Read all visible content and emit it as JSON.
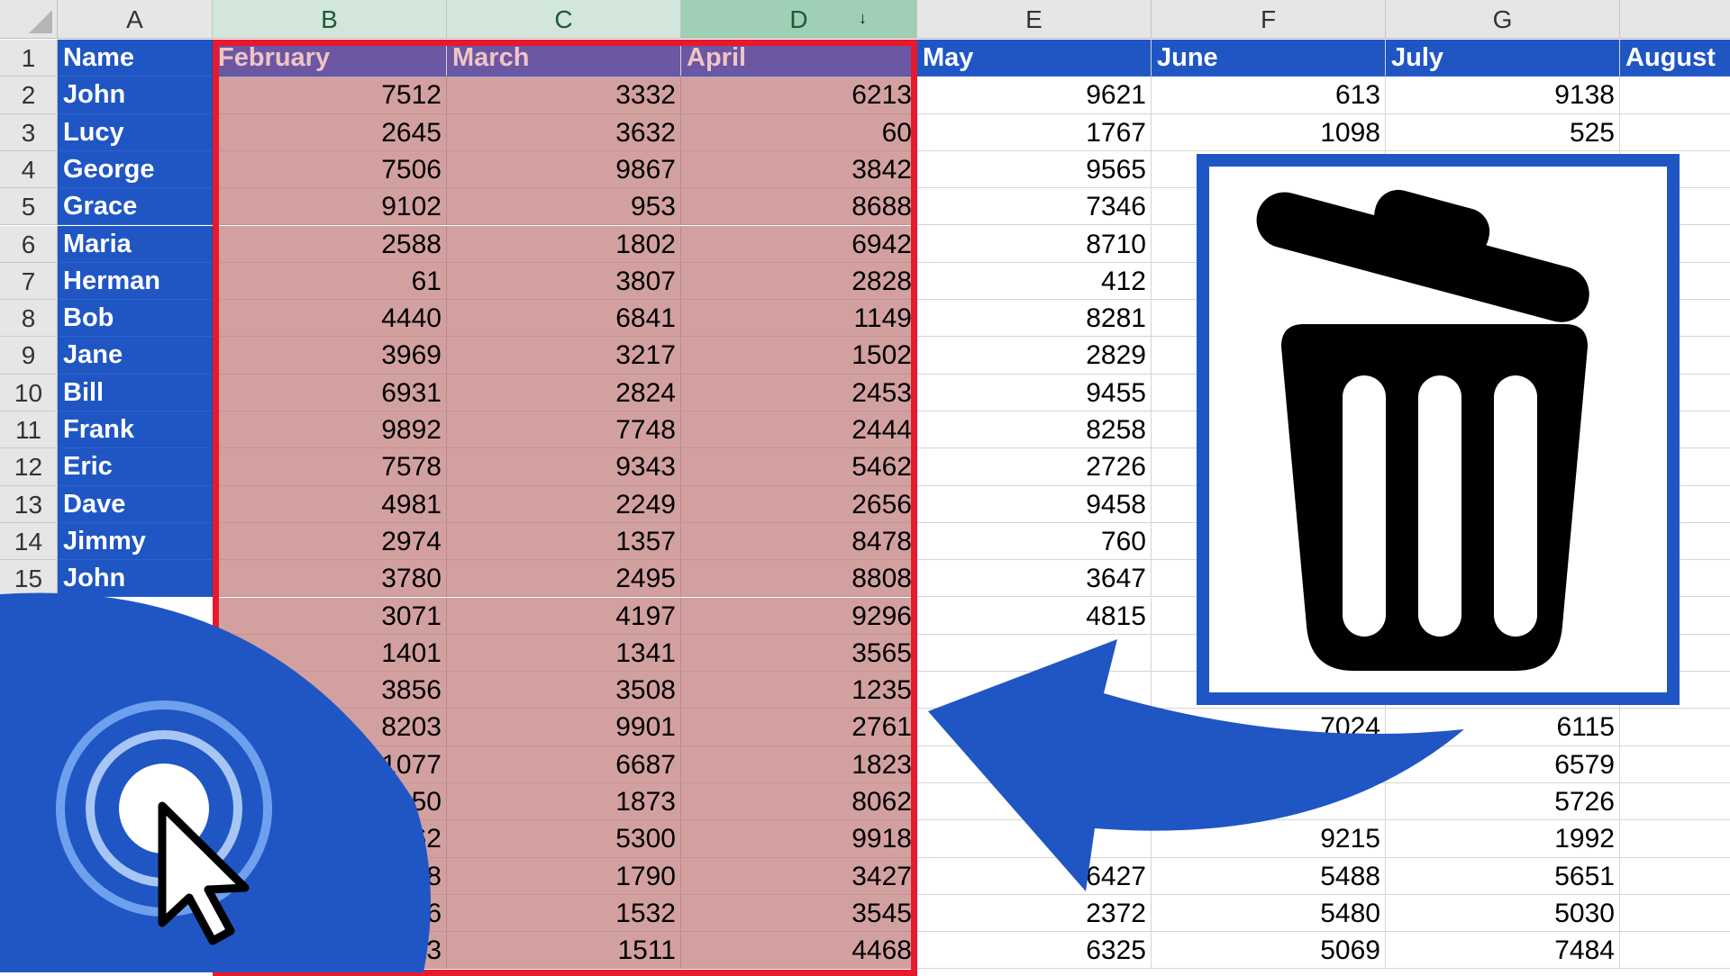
{
  "spreadsheet": {
    "column_letters": [
      "A",
      "B",
      "C",
      "D",
      "E",
      "F",
      "G",
      ""
    ],
    "row_numbers": [
      "1",
      "2",
      "3",
      "4",
      "5",
      "6",
      "7",
      "8",
      "9",
      "10",
      "11",
      "12",
      "13",
      "14",
      "15"
    ],
    "header_row": [
      "Name",
      "February",
      "March",
      "April",
      "May",
      "June",
      "July",
      "August"
    ],
    "names": [
      "John",
      "Lucy",
      "George",
      "Grace",
      "Maria",
      "Herman",
      "Bob",
      "Jane",
      "Bill",
      "Frank",
      "Eric",
      "Dave",
      "Jimmy",
      "John"
    ],
    "rows": [
      [
        "7512",
        "3332",
        "6213",
        "9621",
        "613",
        "9138"
      ],
      [
        "2645",
        "3632",
        "60",
        "1767",
        "1098",
        "525"
      ],
      [
        "7506",
        "9867",
        "3842",
        "9565",
        "",
        ""
      ],
      [
        "9102",
        "953",
        "8688",
        "7346",
        "",
        ""
      ],
      [
        "2588",
        "1802",
        "6942",
        "8710",
        "",
        ""
      ],
      [
        "61",
        "3807",
        "2828",
        "412",
        "",
        ""
      ],
      [
        "4440",
        "6841",
        "1149",
        "8281",
        "",
        ""
      ],
      [
        "3969",
        "3217",
        "1502",
        "2829",
        "",
        ""
      ],
      [
        "6931",
        "2824",
        "2453",
        "9455",
        "",
        ""
      ],
      [
        "9892",
        "7748",
        "2444",
        "8258",
        "",
        ""
      ],
      [
        "7578",
        "9343",
        "5462",
        "2726",
        "",
        ""
      ],
      [
        "4981",
        "2249",
        "2656",
        "9458",
        "",
        ""
      ],
      [
        "2974",
        "1357",
        "8478",
        "760",
        "",
        ""
      ],
      [
        "3780",
        "2495",
        "8808",
        "3647",
        "",
        ""
      ],
      [
        "3071",
        "4197",
        "9296",
        "4815",
        "",
        ""
      ],
      [
        "1401",
        "1341",
        "3565",
        "",
        "",
        ""
      ],
      [
        "3856",
        "3508",
        "1235",
        "",
        "",
        ""
      ],
      [
        "8203",
        "9901",
        "2761",
        "",
        "7024",
        "6115"
      ],
      [
        "1077",
        "6687",
        "1823",
        "",
        "",
        "6579"
      ],
      [
        "9150",
        "1873",
        "8062",
        "",
        "",
        "5726"
      ],
      [
        "462",
        "5300",
        "9918",
        "",
        "9215",
        "1992"
      ],
      [
        "18",
        "1790",
        "3427",
        "6427",
        "5488",
        "5651"
      ],
      [
        "6",
        "1532",
        "3545",
        "2372",
        "5480",
        "5030"
      ],
      [
        "3",
        "1511",
        "4468",
        "6325",
        "5069",
        "7484"
      ]
    ]
  },
  "icons": {
    "trash": "trash-can-icon",
    "arrow": "curved-arrow-icon",
    "logo": "cursor-click-logo-icon"
  },
  "colors": {
    "brand_blue": "#1f56c4",
    "selection_red": "#e8192c",
    "selected_fill": "#d3a0a0",
    "header_green": "#9fcfb4"
  }
}
